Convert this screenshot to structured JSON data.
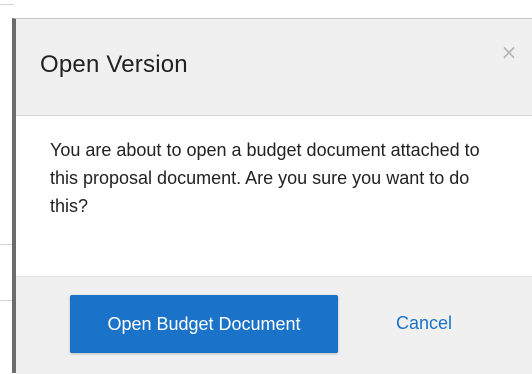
{
  "dialog": {
    "title": "Open Version",
    "close_glyph": "×",
    "close_icon": "close-icon",
    "message": "You are about to open a budget document attached to this proposal document. Are you sure you want to do this?",
    "primary_button": "Open Budget Document",
    "cancel_link": "Cancel"
  },
  "colors": {
    "primary": "#1a73c8",
    "header_bg": "#f0f0f0",
    "footer_bg": "#f0f0f0",
    "text": "#222222",
    "close_icon": "#b5b5b5"
  }
}
